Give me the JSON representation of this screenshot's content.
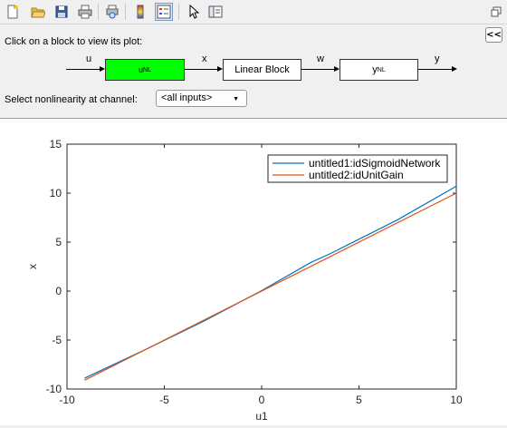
{
  "instruction": "Click on a block to view its plot:",
  "collapse_label": "<<",
  "diagram": {
    "input_signal": "u",
    "block1_main": "u",
    "block1_sub": "NL",
    "signal_x": "x",
    "block2_label": "Linear Block",
    "signal_w": "w",
    "block3_main": "y",
    "block3_sub": "NL",
    "output_signal": "y"
  },
  "channel_select": {
    "label": "Select nonlinearity at channel:",
    "value": "<all inputs>"
  },
  "toolbar": {
    "icons": [
      "new-file-icon",
      "open-folder-icon",
      "save-icon",
      "print-icon",
      "print-preview-icon",
      "colorbar-icon",
      "legend-icon",
      "pointer-icon",
      "property-editor-icon"
    ],
    "undock_icon": "undock-icon"
  },
  "chart_data": {
    "type": "line",
    "xlabel": "u1",
    "ylabel": "x",
    "xlim": [
      -10,
      10
    ],
    "ylim": [
      -10,
      15
    ],
    "xticks": [
      -10,
      -5,
      0,
      5,
      10
    ],
    "yticks": [
      -10,
      -5,
      0,
      5,
      10,
      15
    ],
    "legend_position": "top-right",
    "series": [
      {
        "name": "untitled1:idSigmoidNetwork",
        "color": "#0072bd",
        "points": [
          [
            -9.1,
            -8.9
          ],
          [
            -6,
            -6.0
          ],
          [
            -3,
            -3.1
          ],
          [
            0,
            0.05
          ],
          [
            2.5,
            2.9
          ],
          [
            3.5,
            3.8
          ],
          [
            4,
            4.3
          ],
          [
            5,
            5.3
          ],
          [
            7,
            7.3
          ],
          [
            10,
            10.7
          ]
        ]
      },
      {
        "name": "untitled2:idUnitGain",
        "color": "#d95319",
        "points": [
          [
            -9.1,
            -9.1
          ],
          [
            10,
            10
          ]
        ]
      }
    ]
  }
}
